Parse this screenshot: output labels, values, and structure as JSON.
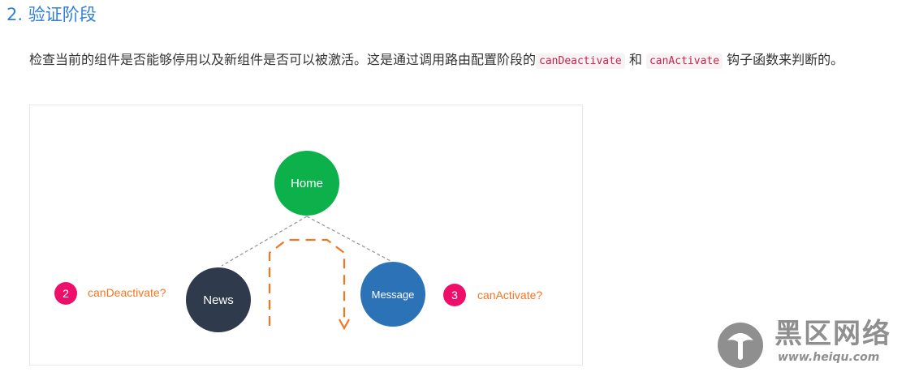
{
  "section": {
    "title": "2. 验证阶段"
  },
  "paragraph": {
    "text_1": "检查当前的组件是否能够停用以及新组件是否可以被激活。这是通过调用路由配置阶段的",
    "code_1": "canDeactivate",
    "text_2": " 和 ",
    "code_2": "canActivate",
    "text_3": " 钩子函数来判断的。"
  },
  "diagram": {
    "nodes": {
      "home": "Home",
      "news": "News",
      "message": "Message"
    },
    "steps": [
      {
        "number": "2",
        "label": "canDeactivate?"
      },
      {
        "number": "3",
        "label": "canActivate?"
      }
    ],
    "colors": {
      "home": "#0cb14b",
      "news": "#2f3a4c",
      "message": "#2b72b6",
      "badge": "#ee0f6b",
      "accent": "#f47521",
      "connector": "#999999"
    }
  },
  "watermark": {
    "text": "黑区网络",
    "url": "www.heiqu.com"
  }
}
